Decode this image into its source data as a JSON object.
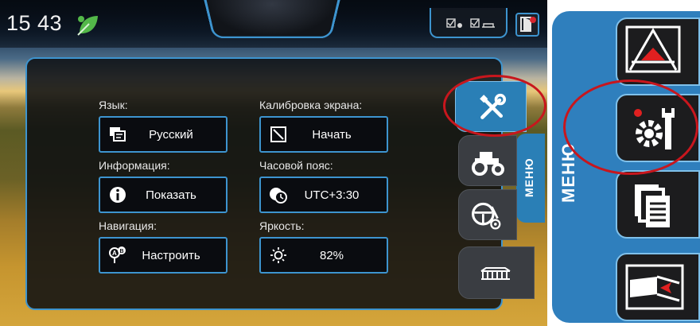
{
  "status_bar": {
    "time": "15 43",
    "icons": [
      "leaf-icon",
      "status-icons",
      "exit-icon"
    ]
  },
  "settings": {
    "language": {
      "label": "Язык:",
      "value": "Русский",
      "icon": "language-icon"
    },
    "calibration": {
      "label": "Калибровка экрана:",
      "value": "Начать",
      "icon": "calibration-icon"
    },
    "info": {
      "label": "Информация:",
      "value": "Показать",
      "icon": "info-icon"
    },
    "timezone": {
      "label": "Часовой пояс:",
      "value": "UTC+3:30",
      "icon": "timezone-icon"
    },
    "navigation": {
      "label": "Навигация:",
      "value": "Настроить",
      "icon": "navigation-ab-icon"
    },
    "brightness": {
      "label": "Яркость:",
      "value": "82%",
      "icon": "brightness-icon"
    }
  },
  "menu": {
    "label": "МЕНЮ",
    "tabs": [
      "settings-tools-icon",
      "tractor-icon",
      "steering-icon",
      "sprayer-icon"
    ],
    "active_tab": "settings-tools-icon"
  },
  "zoom_menu": {
    "label": "МЕНЮ",
    "tiles": [
      "guidance-icon",
      "settings-gear-wrench-icon",
      "documents-icon",
      "field-record-icon"
    ],
    "highlighted": "settings-gear-wrench-icon"
  },
  "colors": {
    "accent": "#3d94cf",
    "highlight": "#c8161d",
    "panel": "#0a0c10"
  }
}
